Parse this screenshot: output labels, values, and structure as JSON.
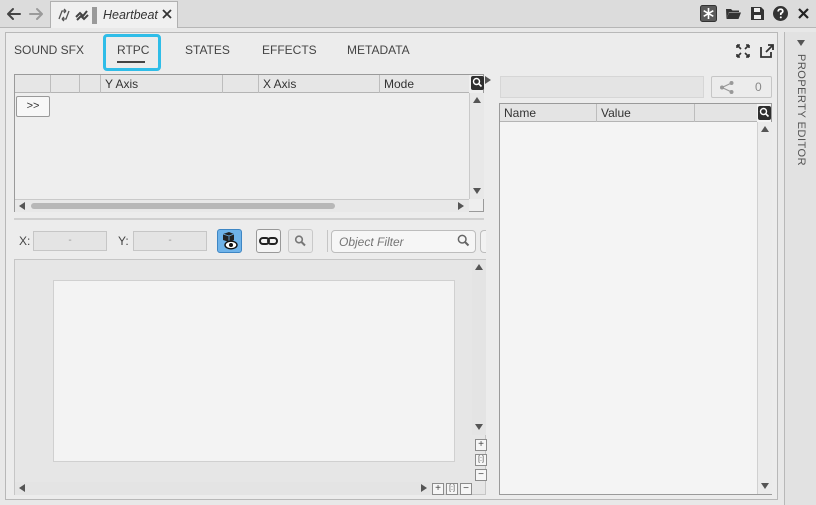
{
  "toolbar": {
    "back_icon": "arrow-left-icon",
    "forward_icon": "arrow-right-icon",
    "right_icons": [
      "asterisk-icon",
      "folder-open-icon",
      "save-icon",
      "help-icon",
      "close-icon"
    ]
  },
  "document_tab": {
    "title": "Heartbeat",
    "icons": [
      "random-container-icon",
      "sound-object-icon"
    ]
  },
  "tabs": [
    {
      "label": "SOUND SFX",
      "active": false
    },
    {
      "label": "RTPC",
      "active": true
    },
    {
      "label": "STATES",
      "active": false
    },
    {
      "label": "EFFECTS",
      "active": false
    },
    {
      "label": "METADATA",
      "active": false
    }
  ],
  "rtpc_grid": {
    "columns": [
      "",
      "",
      "",
      "Y Axis",
      "",
      "X Axis",
      "Mode"
    ],
    "expand_label": ">>"
  },
  "graph_toolbar": {
    "x_label": "X:",
    "y_label": "Y:",
    "x_value": "-",
    "y_value": "-",
    "filter_placeholder": "Object Filter"
  },
  "zoom_controls": {
    "zoom_in": "+",
    "fit": "[:]",
    "zoom_out": "−"
  },
  "property_grid": {
    "columns": [
      "Name",
      "Value"
    ],
    "share_count": "0"
  },
  "side_panel": {
    "label": "PROPERTY EDITOR"
  },
  "colors": {
    "highlight_ring": "#2fbde8",
    "active_tool": "#6fb3e9"
  }
}
